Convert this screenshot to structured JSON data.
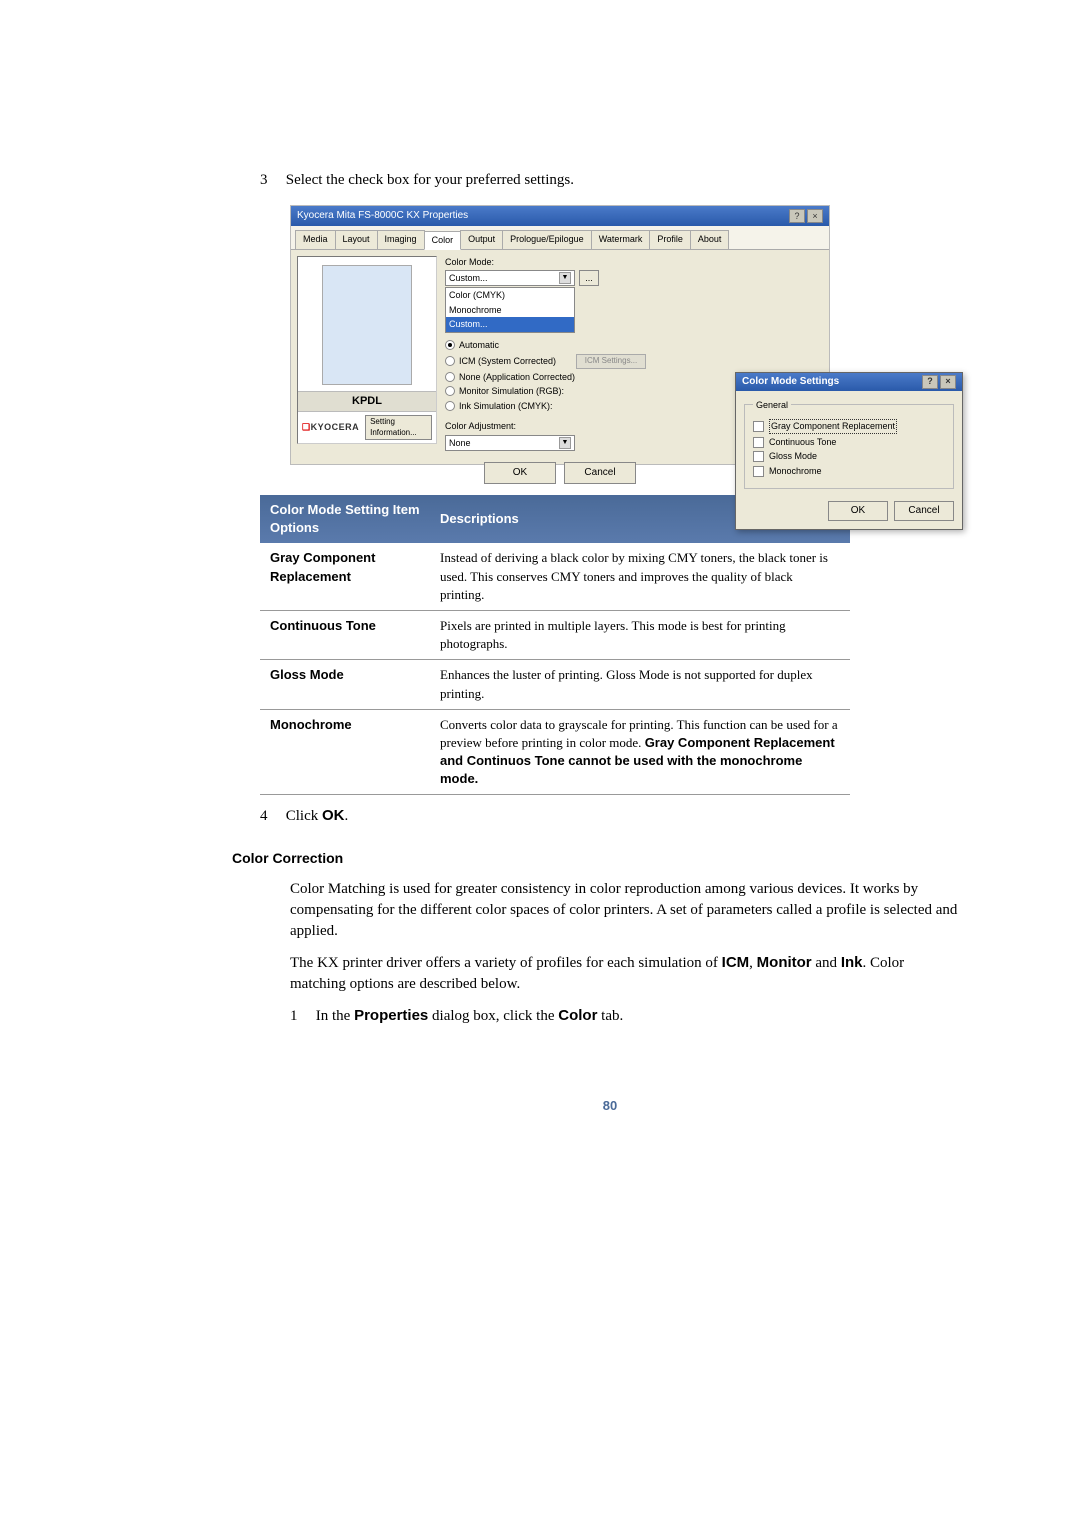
{
  "steps": {
    "s3_num": "3",
    "s3_text": "Select the check box for your preferred settings.",
    "s4_num": "4",
    "s4_text_prefix": "Click ",
    "s4_ok": "OK",
    "s4_text_suffix": ".",
    "s1b_num": "1",
    "s1b_prefix": "In the ",
    "s1b_props": "Properties",
    "s1b_mid": " dialog box, click the ",
    "s1b_color": "Color",
    "s1b_suffix": " tab."
  },
  "dialog": {
    "title": "Kyocera Mita FS-8000C KX Properties",
    "tabs": [
      "Media",
      "Layout",
      "Imaging",
      "Color",
      "Output",
      "Prologue/Epilogue",
      "Watermark",
      "Profile",
      "About"
    ],
    "preview_label": "KPDL",
    "kyocera": "KYOCERA",
    "setting_info": "Setting Information...",
    "color_mode_label": "Color Mode:",
    "combo_value": "Custom...",
    "combo_opts": [
      "Color (CMYK)",
      "Monochrome",
      "Custom..."
    ],
    "ellipsis": "...",
    "radios": {
      "auto": "Automatic",
      "icm": "ICM (System Corrected)",
      "none": "None (Application Corrected)",
      "monitor": "Monitor Simulation (RGB):",
      "ink": "Ink Simulation (CMYK):"
    },
    "icm_settings_btn": "ICM Settings...",
    "color_adj_label": "Color Adjustment:",
    "color_adj_value": "None",
    "ok": "OK",
    "cancel": "Cancel"
  },
  "inner": {
    "title": "Color Mode Settings",
    "legend": "General",
    "chk_gcr": "Gray Component Replacement",
    "chk_ct": "Continuous Tone",
    "chk_gloss": "Gloss Mode",
    "chk_mono": "Monochrome",
    "ok": "OK",
    "cancel": "Cancel"
  },
  "table": {
    "h1": "Color Mode Setting Item Options",
    "h2": "Descriptions",
    "rows": [
      {
        "opt": "Gray Component Replacement",
        "desc": "Instead of deriving a black color by mixing CMY toners, the black toner is used. This conserves CMY toners and improves the quality of black printing."
      },
      {
        "opt": "Continuous Tone",
        "desc": "Pixels are printed in multiple layers. This mode is best for printing photographs."
      },
      {
        "opt": "Gloss Mode",
        "desc": "Enhances the luster of printing. Gloss Mode is not supported for duplex printing."
      },
      {
        "opt": "Monochrome",
        "desc_pre": "Converts color data to grayscale for printing. This function can be used for a preview before printing in color mode. ",
        "desc_bold": "Gray Component Replacement and Continuos Tone cannot be used with the monochrome mode."
      }
    ]
  },
  "section": {
    "heading": "Color Correction",
    "p1": "Color Matching is used for greater consistency in color reproduction among various devices. It works by compensating for the different color spaces of color printers. A set of parameters called a profile is selected and applied.",
    "p2_pre": "The KX printer driver offers a variety of profiles for each simulation of ",
    "p2_icm": "ICM",
    "p2_c1": ", ",
    "p2_mon": "Monitor",
    "p2_and": " and ",
    "p2_ink": "Ink",
    "p2_post": ". Color matching options are described below."
  },
  "page_number": "80",
  "chart_data": {
    "type": "table",
    "title": "Color Mode Setting Item Options / Descriptions",
    "columns": [
      "Color Mode Setting Item Options",
      "Descriptions"
    ],
    "rows": [
      [
        "Gray Component Replacement",
        "Instead of deriving a black color by mixing CMY toners, the black toner is used. This conserves CMY toners and improves the quality of black printing."
      ],
      [
        "Continuous Tone",
        "Pixels are printed in multiple layers. This mode is best for printing photographs."
      ],
      [
        "Gloss Mode",
        "Enhances the luster of printing. Gloss Mode is not supported for duplex printing."
      ],
      [
        "Monochrome",
        "Converts color data to grayscale for printing. This function can be used for a preview before printing in color mode. Gray Component Replacement and Continuos Tone cannot be used with the monochrome mode."
      ]
    ]
  }
}
